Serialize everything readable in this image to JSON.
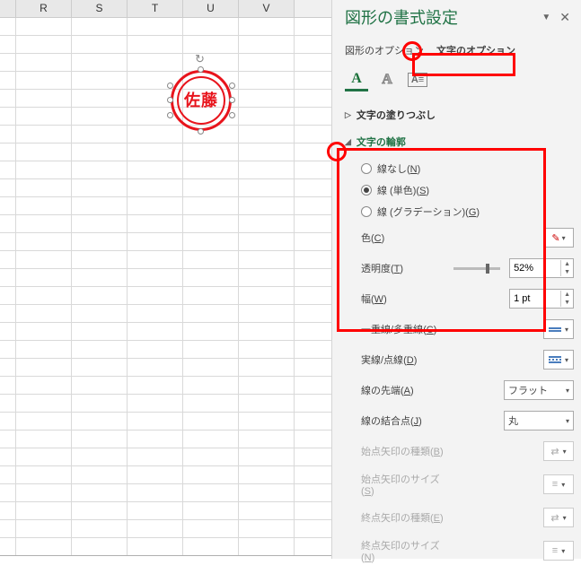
{
  "columns": [
    "R",
    "S",
    "T",
    "U",
    "V"
  ],
  "stamp_text": "佐藤",
  "pane": {
    "title": "図形の書式設定",
    "tabs": {
      "shape": "図形のオプション",
      "text": "文字のオプション"
    },
    "sections": {
      "fill": "文字の塗りつぶし",
      "outline": "文字の輪郭"
    },
    "outline_radios": {
      "none": {
        "label": "線なし",
        "key": "N"
      },
      "solid": {
        "label": "線 (単色)",
        "key": "S"
      },
      "grad": {
        "label": "線 (グラデーション)",
        "key": "G"
      }
    },
    "props": {
      "color": {
        "label": "色",
        "key": "C"
      },
      "transparency": {
        "label": "透明度",
        "key": "T",
        "value": "52%"
      },
      "width": {
        "label": "幅",
        "key": "W",
        "value": "1 pt"
      },
      "compound": {
        "label": "一重線/多重線",
        "key": "C"
      },
      "dash": {
        "label": "実線/点線",
        "key": "D"
      },
      "cap": {
        "label": "線の先端",
        "key": "A",
        "value": "フラット"
      },
      "join": {
        "label": "線の結合点",
        "key": "J",
        "value": "丸"
      },
      "beginType": {
        "label": "始点矢印の種類",
        "key": "B"
      },
      "beginSize": {
        "label": "始点矢印のサイズ",
        "key": "S"
      },
      "endType": {
        "label": "終点矢印の種類",
        "key": "E"
      },
      "endSize": {
        "label": "終点矢印のサイズ",
        "key": "N"
      }
    }
  }
}
